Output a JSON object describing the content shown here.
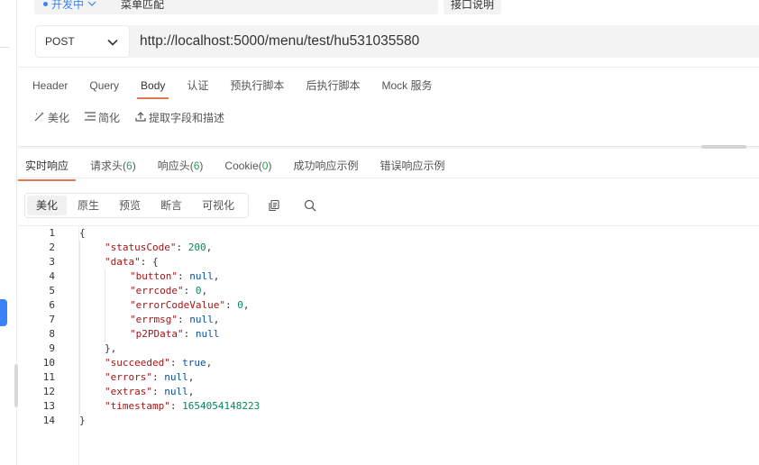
{
  "top": {
    "status_label": "开发中",
    "name_value": "菜单匹配",
    "doc_button": "接口说明"
  },
  "request": {
    "method": "POST",
    "url": "http://localhost:5000/menu/test/hu531035580",
    "tabs": [
      "Header",
      "Query",
      "Body",
      "认证",
      "预执行脚本",
      "后执行脚本",
      "Mock 服务"
    ],
    "active_tab": "Body",
    "body_tools": {
      "beautify": "美化",
      "simplify": "简化",
      "extract": "提取字段和描述"
    }
  },
  "response": {
    "tabs": {
      "realtime": "实时响应",
      "req_headers": "请求头",
      "req_headers_count": "6",
      "resp_headers": "响应头",
      "resp_headers_count": "6",
      "cookie": "Cookie",
      "cookie_count": "0",
      "success_example": "成功响应示例",
      "error_example": "错误响应示例"
    },
    "view_modes": [
      "美化",
      "原生",
      "预览",
      "断言",
      "可视化"
    ],
    "active_view": "美化",
    "code_lines": [
      {
        "n": "1",
        "indent": 0,
        "parts": [
          [
            "p",
            "{"
          ]
        ]
      },
      {
        "n": "2",
        "indent": 1,
        "parts": [
          [
            "k",
            "\"statusCode\""
          ],
          [
            "p",
            ": "
          ],
          [
            "v",
            "200"
          ],
          [
            "p",
            ","
          ]
        ]
      },
      {
        "n": "3",
        "indent": 1,
        "parts": [
          [
            "k",
            "\"data\""
          ],
          [
            "p",
            ": {"
          ]
        ]
      },
      {
        "n": "4",
        "indent": 2,
        "parts": [
          [
            "k",
            "\"button\""
          ],
          [
            "p",
            ": "
          ],
          [
            "n",
            "null"
          ],
          [
            "p",
            ","
          ]
        ]
      },
      {
        "n": "5",
        "indent": 2,
        "parts": [
          [
            "k",
            "\"errcode\""
          ],
          [
            "p",
            ": "
          ],
          [
            "v",
            "0"
          ],
          [
            "p",
            ","
          ]
        ]
      },
      {
        "n": "6",
        "indent": 2,
        "parts": [
          [
            "k",
            "\"errorCodeValue\""
          ],
          [
            "p",
            ": "
          ],
          [
            "v",
            "0"
          ],
          [
            "p",
            ","
          ]
        ]
      },
      {
        "n": "7",
        "indent": 2,
        "parts": [
          [
            "k",
            "\"errmsg\""
          ],
          [
            "p",
            ": "
          ],
          [
            "n",
            "null"
          ],
          [
            "p",
            ","
          ]
        ]
      },
      {
        "n": "8",
        "indent": 2,
        "parts": [
          [
            "k",
            "\"p2PData\""
          ],
          [
            "p",
            ": "
          ],
          [
            "n",
            "null"
          ]
        ]
      },
      {
        "n": "9",
        "indent": 1,
        "parts": [
          [
            "p",
            "},"
          ]
        ]
      },
      {
        "n": "10",
        "indent": 1,
        "parts": [
          [
            "k",
            "\"succeeded\""
          ],
          [
            "p",
            ": "
          ],
          [
            "n",
            "true"
          ],
          [
            "p",
            ","
          ]
        ]
      },
      {
        "n": "11",
        "indent": 1,
        "parts": [
          [
            "k",
            "\"errors\""
          ],
          [
            "p",
            ": "
          ],
          [
            "n",
            "null"
          ],
          [
            "p",
            ","
          ]
        ]
      },
      {
        "n": "12",
        "indent": 1,
        "parts": [
          [
            "k",
            "\"extras\""
          ],
          [
            "p",
            ": "
          ],
          [
            "n",
            "null"
          ],
          [
            "p",
            ","
          ]
        ]
      },
      {
        "n": "13",
        "indent": 1,
        "parts": [
          [
            "k",
            "\"timestamp\""
          ],
          [
            "p",
            ": "
          ],
          [
            "v",
            "1654054148223"
          ]
        ]
      },
      {
        "n": "14",
        "indent": 0,
        "parts": [
          [
            "p",
            "}"
          ]
        ]
      }
    ]
  },
  "colors": {
    "accent": "#e07a52",
    "status_blue": "#3b82f6",
    "count_green": "#2e9e5b",
    "json_key": "#a31515",
    "json_number": "#098658",
    "json_literal": "#0451a5"
  }
}
